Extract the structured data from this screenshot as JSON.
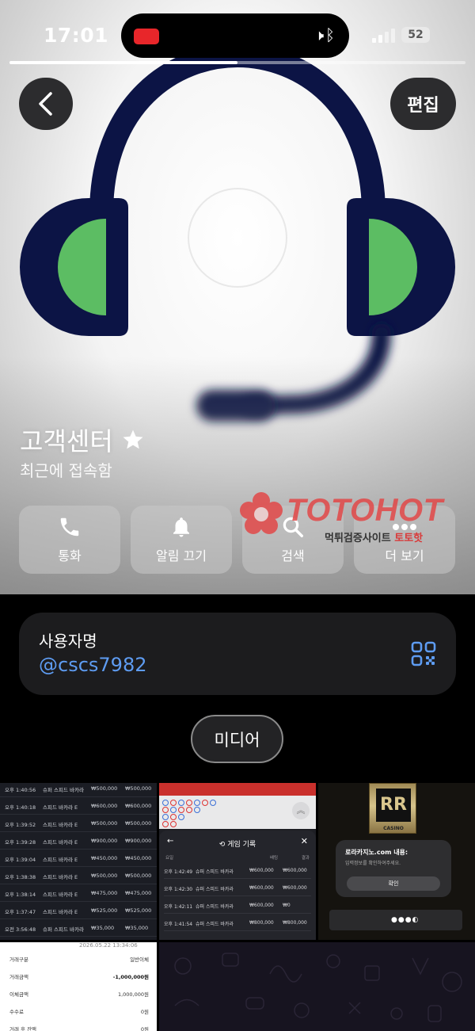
{
  "status_bar": {
    "time": "17:01",
    "battery": "52",
    "icons": [
      "mute-icon",
      "bluetooth-icon",
      "signal-icon"
    ],
    "story_progress": 0.5
  },
  "header": {
    "back_icon": "chevron-left-icon",
    "edit_label": "편집"
  },
  "profile": {
    "avatar": "headset-icon",
    "name": "고객센터",
    "name_badge": "star-icon",
    "status": "최근에 접속함"
  },
  "actions": [
    {
      "label": "통화",
      "icon": "phone-icon"
    },
    {
      "label": "알림 끄기",
      "icon": "bell-icon"
    },
    {
      "label": "검색",
      "icon": "search-icon"
    },
    {
      "label": "더 보기",
      "icon": "more-icon"
    }
  ],
  "watermark": {
    "brand": "TOTOHOT",
    "sub": "먹튀검증사이트",
    "sub_highlight": "토토핫"
  },
  "username_card": {
    "label": "사용자명",
    "value": "@cscs7982",
    "qr_icon": "qr-code-icon"
  },
  "media_tab": {
    "label": "미디어"
  },
  "media": {
    "thumb1_rows": [
      {
        "time": "오후 1:40:56",
        "game": "슈퍼 스피드 바카라",
        "bet": "₩500,000",
        "result": "₩500,000"
      },
      {
        "time": "오후 1:40:18",
        "game": "스피드 바카라 E",
        "bet": "₩600,000",
        "result": "₩600,000"
      },
      {
        "time": "오후 1:39:52",
        "game": "스피드 바카라 E",
        "bet": "₩500,000",
        "result": "₩500,000"
      },
      {
        "time": "오후 1:39:28",
        "game": "스피드 바카라 E",
        "bet": "₩900,000",
        "result": "₩900,000"
      },
      {
        "time": "오후 1:39:04",
        "game": "스피드 바카라 E",
        "bet": "₩450,000",
        "result": "₩450,000"
      },
      {
        "time": "오후 1:38:38",
        "game": "스피드 바카라 E",
        "bet": "₩500,000",
        "result": "₩500,000"
      },
      {
        "time": "오후 1:38:14",
        "game": "스피드 바카라 E",
        "bet": "₩475,000",
        "result": "₩475,000"
      },
      {
        "time": "오후 1:37:47",
        "game": "스피드 바카라 E",
        "bet": "₩525,000",
        "result": "₩525,000"
      },
      {
        "time": "오전 3:56:48",
        "game": "슈퍼 스피드 바카라",
        "bet": "₩35,000",
        "result": "₩35,000"
      }
    ],
    "thumb2_title": "게임 기록",
    "thumb2_head": {
      "col1": "요일",
      "col2": "배팅",
      "col3": "결과"
    },
    "thumb2_rows": [
      {
        "time": "오후 1:42:49",
        "game": "슈퍼 스피드 바카라",
        "bet": "₩600,000",
        "result": "₩600,000"
      },
      {
        "time": "오후 1:42:30",
        "game": "슈퍼 스피드 바카라",
        "bet": "₩600,000",
        "result": "₩600,000"
      },
      {
        "time": "오후 1:42:11",
        "game": "슈퍼 스피드 바카라",
        "bet": "₩600,000",
        "result": "₩0"
      },
      {
        "time": "오후 1:41:54",
        "game": "슈퍼 스피드 바카라",
        "bet": "₩800,000",
        "result": "₩800,000"
      }
    ],
    "thumb3_logo_letters": "RR",
    "thumb3_logo_caption": "CASINO",
    "thumb3_dialog_title": "로라카지노.com 내용:",
    "thumb3_dialog_body": "입력정보를 확인하여주세요.",
    "thumb3_dialog_button": "확인",
    "thumb3_dots": "●●●◐",
    "thumb4_date": "2026.05.22 13:34:06",
    "thumb4_rows": [
      {
        "label": "거래구분",
        "value": "일반이체"
      },
      {
        "label": "거래금액",
        "value": "-1,000,000원"
      },
      {
        "label": "이체금액",
        "value": "1,000,000원"
      },
      {
        "label": "수수료",
        "value": "0원"
      },
      {
        "label": "거래 후 잔액",
        "value": "0원"
      }
    ]
  },
  "colors": {
    "link_blue": "#5e9cf2",
    "card_bg": "#1c1c1e",
    "headset_navy": "#0c1445",
    "headset_green": "#5cbd63"
  }
}
